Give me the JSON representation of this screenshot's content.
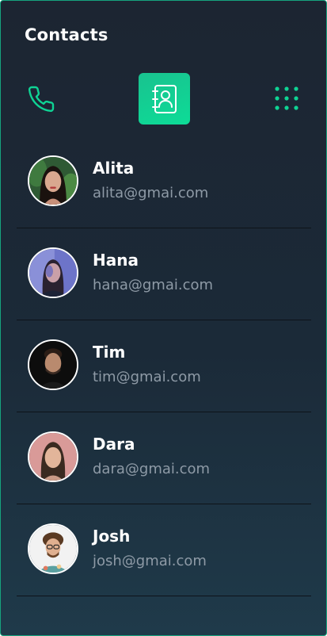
{
  "header": {
    "title": "Contacts"
  },
  "toolbar": {
    "phone_icon": "phone-icon",
    "contacts_icon": "address-book-icon",
    "grid_icon": "dialpad-grid-icon",
    "accent_color": "#0fd394"
  },
  "contacts": [
    {
      "name": "Alita",
      "email": "alita@gmai.com"
    },
    {
      "name": "Hana",
      "email": "hana@gmai.com"
    },
    {
      "name": "Tim",
      "email": "tim@gmai.com"
    },
    {
      "name": "Dara",
      "email": "dara@gmai.com"
    },
    {
      "name": "Josh",
      "email": "josh@gmai.com"
    }
  ],
  "colors": {
    "background": "#1c2532",
    "text_primary": "#ffffff",
    "text_secondary": "#8e9aa6",
    "divider": "#0e1319"
  }
}
